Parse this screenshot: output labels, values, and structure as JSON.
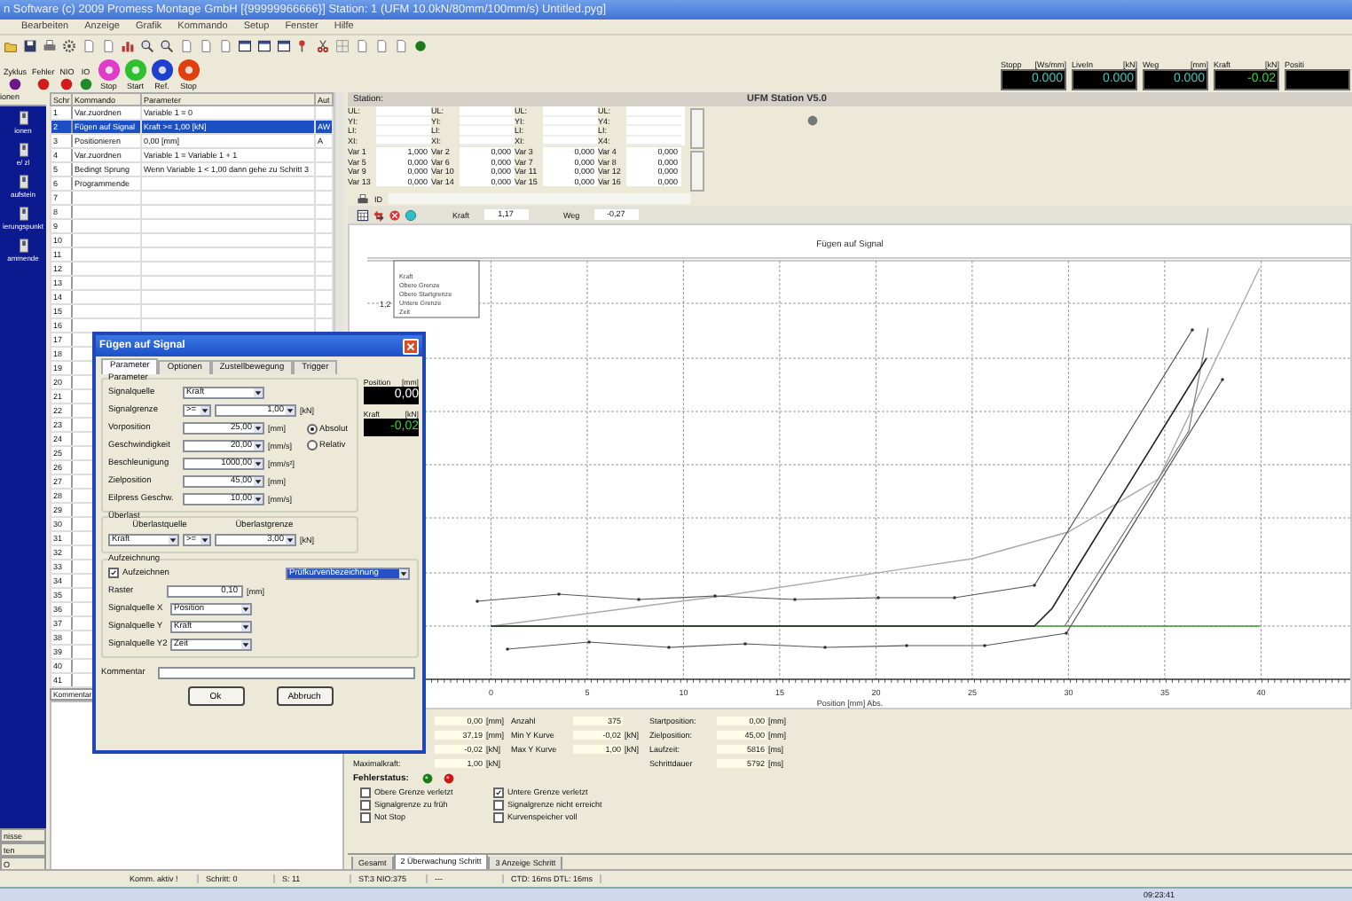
{
  "window": {
    "title": "n Software (c) 2009 Promess Montage GmbH   [{99999966666}] Station: 1 (UFM 10.0kN/80mm/100mm/s) Untitled.pyg]"
  },
  "menu": [
    "Bearbeiten",
    "Anzeige",
    "Grafik",
    "Kommando",
    "Setup",
    "Fenster",
    "Hilfe"
  ],
  "lamps": [
    {
      "label": "Zyklus",
      "color": "#6a1a86"
    },
    {
      "label": "Fehler",
      "color": "#d21c1c"
    },
    {
      "label": "NIO",
      "color": "#d21c1c"
    },
    {
      "label": "IO",
      "color": "#1f8a2a"
    }
  ],
  "big_buttons": [
    {
      "label": "Stop",
      "color": "#e03cc8"
    },
    {
      "label": "Start",
      "color": "#2fbf2f"
    },
    {
      "label": "Ref.",
      "color": "#1f3fd0"
    },
    {
      "label": "Stop",
      "color": "#e0400e"
    }
  ],
  "readouts": [
    {
      "label": "Stopp",
      "unit": "[Ws/mm]",
      "value": "0.000",
      "kind": "signal"
    },
    {
      "label": "LiveIn",
      "unit": "[kN]",
      "value": "0.000",
      "kind": "signal"
    },
    {
      "label": "Weg",
      "unit": "[mm]",
      "value": "0.000",
      "kind": "signal"
    },
    {
      "label": "Kraft",
      "unit": "[kN]",
      "value": "-0.02",
      "kind": "force"
    },
    {
      "label": "Positi"
    }
  ],
  "sidebar": {
    "header": "ionen",
    "items": [
      "ionen",
      "e/ zl",
      "aufstein",
      "ierungspunkt",
      "ammende"
    ],
    "buttons": [
      "nisse",
      "ten",
      "O"
    ]
  },
  "program": {
    "columns": [
      "Schr",
      "Kommando",
      "Parameter",
      "Aut"
    ],
    "rows": [
      {
        "step": "1",
        "command": "Var.zuordnen",
        "parameter": "Variable 1 = 0",
        "auto": "",
        "selected": false
      },
      {
        "step": "2",
        "command": "Fügen auf Signal",
        "parameter": "Kraft >= 1,00 [kN]",
        "auto": "AW",
        "selected": true
      },
      {
        "step": "3",
        "command": "Positionieren",
        "parameter": "0,00 [mm]",
        "auto": "A",
        "selected": false
      },
      {
        "step": "4",
        "command": "Var.zuordnen",
        "parameter": "Variable 1 = Variable 1 + 1",
        "auto": "",
        "selected": false
      },
      {
        "step": "5",
        "command": "Bedingt Sprung",
        "parameter": "Wenn Variable 1 < 1,00 dann gehe zu Schritt 3",
        "auto": "",
        "selected": false
      },
      {
        "step": "6",
        "command": "Programmende",
        "parameter": "",
        "auto": "",
        "selected": false
      },
      {
        "step": "7",
        "selected": false
      },
      {
        "step": "8",
        "selected": false
      },
      {
        "step": "9",
        "selected": false
      },
      {
        "step": "10",
        "selected": false
      },
      {
        "step": "11",
        "selected": false
      },
      {
        "step": "12",
        "selected": false
      },
      {
        "step": "13",
        "selected": false
      },
      {
        "step": "14",
        "selected": false
      },
      {
        "step": "15",
        "selected": false
      },
      {
        "step": "16",
        "selected": false
      },
      {
        "step": "17",
        "selected": false
      },
      {
        "step": "18",
        "selected": false
      },
      {
        "step": "19",
        "selected": false
      },
      {
        "step": "20",
        "selected": false
      },
      {
        "step": "21",
        "selected": false
      },
      {
        "step": "22",
        "selected": false
      },
      {
        "step": "23",
        "selected": false
      },
      {
        "step": "24",
        "selected": false
      },
      {
        "step": "25",
        "selected": false
      },
      {
        "step": "26",
        "selected": false
      },
      {
        "step": "27",
        "selected": false
      },
      {
        "step": "28",
        "selected": false
      },
      {
        "step": "29",
        "selected": false
      },
      {
        "step": "30",
        "selected": false
      },
      {
        "step": "31",
        "selected": false
      },
      {
        "step": "32",
        "selected": false
      },
      {
        "step": "33",
        "selected": false
      },
      {
        "step": "34",
        "selected": false
      },
      {
        "step": "35",
        "selected": false
      },
      {
        "step": "36",
        "selected": false
      },
      {
        "step": "37",
        "selected": false
      },
      {
        "step": "38",
        "selected": false
      },
      {
        "step": "39",
        "selected": false
      },
      {
        "step": "40",
        "selected": false
      },
      {
        "step": "41",
        "selected": false
      }
    ],
    "comment_tab": "Kommentar"
  },
  "station": {
    "label": "Station:",
    "heading": "UFM Station V5.0",
    "limit_labels": [
      "UL:",
      "UL:",
      "UL:",
      "UL:",
      "YI:",
      "YI:",
      "YI:",
      "Y4:",
      "LI:",
      "LI:",
      "LI:",
      "LI:",
      "XI:",
      "XI:",
      "XI:",
      "X4:"
    ],
    "vars": [
      {
        "name": "Var 1",
        "value": "1,000"
      },
      {
        "name": "Var 2",
        "value": "0,000"
      },
      {
        "name": "Var 3",
        "value": "0,000"
      },
      {
        "name": "Var 4",
        "value": "0,000"
      },
      {
        "name": "Var 5",
        "value": "0,000"
      },
      {
        "name": "Var 6",
        "value": "0,000"
      },
      {
        "name": "Var 7",
        "value": "0,000"
      },
      {
        "name": "Var 8",
        "value": "0,000"
      },
      {
        "name": "Var 9",
        "value": "0,000"
      },
      {
        "name": "Var 10",
        "value": "0,000"
      },
      {
        "name": "Var 11",
        "value": "0,000"
      },
      {
        "name": "Var 12",
        "value": "0,000"
      },
      {
        "name": "Var 13",
        "value": "0,000"
      },
      {
        "name": "Var 14",
        "value": "0,000"
      },
      {
        "name": "Var 15",
        "value": "0,000"
      },
      {
        "name": "Var 16",
        "value": "0,000"
      }
    ]
  },
  "id_label": "ID",
  "live": [
    {
      "label": "Kraft",
      "value": "1,17"
    },
    {
      "label": "Weg",
      "value": "-0,27"
    }
  ],
  "chart": {
    "title": "Fügen auf Signal",
    "xlabel": "Position [mm] Abs.",
    "x_ticks": [
      "0",
      "5",
      "10",
      "15",
      "20",
      "25",
      "30",
      "35",
      "40"
    ],
    "y_ticks": [
      "1,2"
    ],
    "legend": [
      "Kraft",
      "Obere Grenze",
      "Obere Startgrenze",
      "Untere Grenze",
      "Zeit"
    ]
  },
  "results": {
    "columns": [
      [
        {
          "value": "0,00",
          "unit": "[mm]"
        },
        {
          "value": "37,19",
          "unit": "[mm]"
        },
        {
          "value": "-0,02",
          "unit": "[kN]"
        },
        {
          "label": "Maximalkraft:",
          "value": "1,00",
          "unit": "[kN]"
        }
      ],
      [
        {
          "label": "Anzahl",
          "value": "375"
        },
        {
          "label": "Min Y Kurve",
          "value": "-0,02",
          "unit": "[kN]"
        },
        {
          "label": "Max Y Kurve",
          "value": "1,00",
          "unit": "[kN]"
        }
      ],
      [
        {
          "label": "Startposition:",
          "value": "0,00",
          "unit": "[mm]"
        },
        {
          "label": "Zielposition:",
          "value": "45,00",
          "unit": "[mm]"
        },
        {
          "label": "Laufzeit:",
          "value": "5816",
          "unit": "[ms]"
        },
        {
          "label": "Schrittdauer",
          "value": "5792",
          "unit": "[ms]"
        }
      ]
    ],
    "error_label": "Fehlerstatus:",
    "flags": [
      {
        "label": "Obere Grenze verletzt",
        "checked": false
      },
      {
        "label": "Signalgrenze zu früh",
        "checked": false
      },
      {
        "label": "Not Stop",
        "checked": false
      },
      {
        "label": "Untere Grenze verletzt",
        "checked": true
      },
      {
        "label": "Signalgrenze nicht erreicht",
        "checked": false
      },
      {
        "label": "Kurvenspeicher voll",
        "checked": false
      }
    ]
  },
  "tabs": [
    {
      "label": "Gesamt",
      "selected": false
    },
    {
      "label": "2 Überwachung Schritt",
      "selected": true
    },
    {
      "label": "3 Anzeige Schritt",
      "selected": false
    }
  ],
  "status_bar": [
    "Komm. aktiv !",
    "Schritt: 0",
    "S: 11",
    "ST:3 NIO:375",
    "---",
    "CTD: 16ms DTL: 16ms"
  ],
  "clock": "09:23:41",
  "dialog": {
    "title": "Fügen auf Signal",
    "tabs": [
      {
        "label": "Parameter",
        "selected": true
      },
      {
        "label": "Optionen",
        "selected": false
      },
      {
        "label": "Zustellbewegung",
        "selected": false
      },
      {
        "label": "Trigger",
        "selected": false
      }
    ],
    "parameter_group": {
      "title": "Parameter",
      "rows": [
        {
          "kind": "combo",
          "label": "Signalquelle",
          "value": "Kraft"
        },
        {
          "kind": "limit",
          "label": "Signalgrenze",
          "operator": ">=",
          "value": "1,00",
          "unit": "[kN]"
        },
        {
          "kind": "number",
          "label": "Vorposition",
          "value": "25,00",
          "unit": "[mm]"
        },
        {
          "kind": "number",
          "label": "Geschwindigkeit",
          "value": "20,00",
          "unit": "[mm/s]"
        },
        {
          "kind": "number",
          "label": "Beschleunigung",
          "value": "1000,00",
          "unit": "[mm/s²]"
        },
        {
          "kind": "number",
          "label": "Zielposition",
          "value": "45,00",
          "unit": "[mm]"
        },
        {
          "kind": "number",
          "label": "Eilpress Geschw.",
          "value": "10,00",
          "unit": "[mm/s]"
        }
      ],
      "modes": [
        {
          "label": "Absolut",
          "selected": true
        },
        {
          "label": "Relativ",
          "selected": false
        }
      ]
    },
    "readouts": [
      {
        "label": "Position",
        "unit": "[mm]",
        "value": "0,00",
        "kind": "position"
      },
      {
        "label": "Kraft",
        "unit": "[kN]",
        "value": "-0,02",
        "kind": "force"
      }
    ],
    "overload": {
      "title": "Überlast",
      "source_label": "Überlastquelle",
      "limit_label": "Überlastgrenze",
      "source": "Kraft",
      "operator": ">=",
      "value": "3,00",
      "unit": "[kN]"
    },
    "recording": {
      "title": "Aufzeichnung",
      "enabled": {
        "label": "Aufzeichnen",
        "checked": true
      },
      "raster": {
        "label": "Raster",
        "value": "0,10",
        "unit": "[mm]"
      },
      "sources": [
        {
          "label": "Signalquelle X",
          "value": "Position"
        },
        {
          "label": "Signalquelle Y",
          "value": "Kraft"
        },
        {
          "label": "Signalquelle Y2",
          "value": "Zeit"
        }
      ],
      "curve": "Prüfkurvenbezeichnung"
    },
    "comment_label": "Kommentar",
    "buttons": [
      "Ok",
      "Abbruch"
    ]
  }
}
